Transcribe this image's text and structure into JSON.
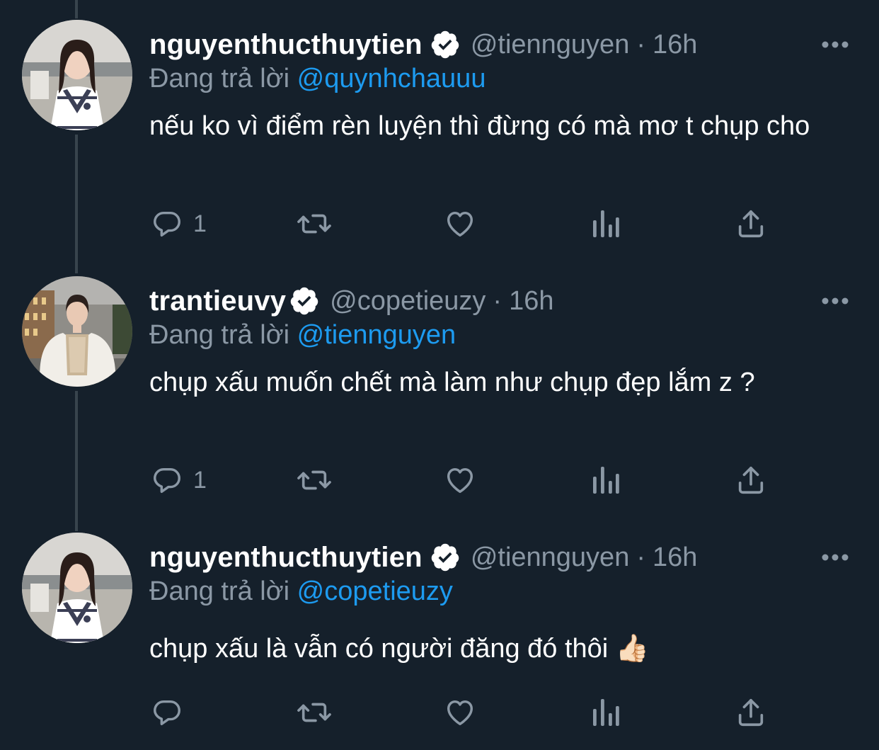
{
  "tweets": [
    {
      "display_name": "nguyenthucthuytien",
      "handle": "@tiennguyen",
      "separator": "·",
      "time": "16h",
      "reply_prefix": "Đang trả lời",
      "reply_to": "@quynhchauuu",
      "text": "nếu ko vì điểm rèn luyện thì đừng có mà mơ t chụp cho",
      "reply_count": "1",
      "avatar": "woman-in-white-sweater-vest"
    },
    {
      "display_name": "trantieuvy",
      "handle": "@copetieuzy",
      "separator": "·",
      "time": "16h",
      "reply_prefix": "Đang trả lời",
      "reply_to": "@tiennguyen",
      "text": "chụp xấu muốn chết mà làm như chụp đẹp lắm z ?",
      "reply_count": "1",
      "avatar": "woman-in-white-fur-gown"
    },
    {
      "display_name": "nguyenthucthuytien",
      "handle": "@tiennguyen",
      "separator": "·",
      "time": "16h",
      "reply_prefix": "Đang trả lời",
      "reply_to": "@copetieuzy",
      "text": "chụp xấu là vẫn có người đăng đó thôi 👍🏻",
      "reply_count": "",
      "avatar": "woman-in-white-sweater-vest"
    }
  ],
  "icons": {
    "verified": "verified-badge-icon",
    "more": "more-dots-icon",
    "reply": "reply-bubble-icon",
    "retweet": "retweet-icon",
    "like": "heart-icon",
    "views": "analytics-bars-icon",
    "share": "share-upload-icon"
  },
  "colors": {
    "background": "#15202b",
    "primary_text": "#ffffff",
    "secondary_text": "#8b98a5",
    "link": "#1d9bf0",
    "thread_line": "#38444d"
  }
}
